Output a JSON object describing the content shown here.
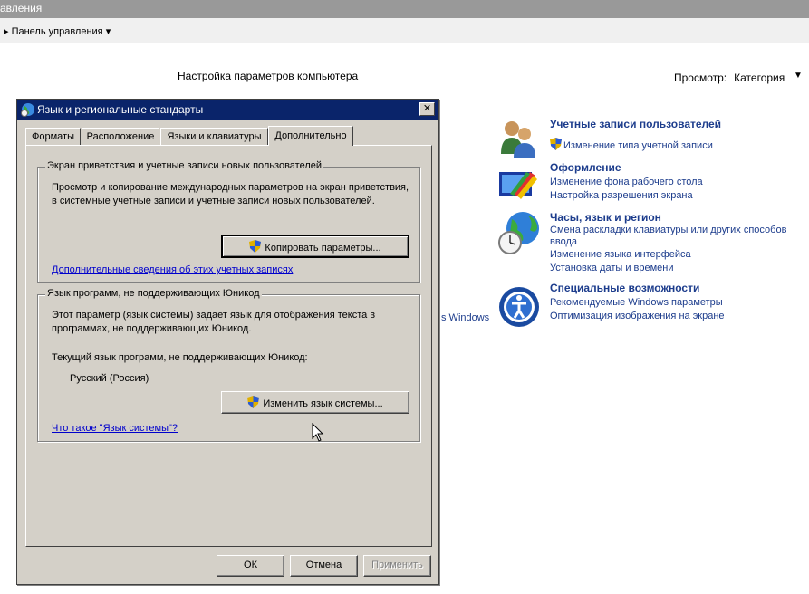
{
  "control_panel": {
    "title_fragment": "авления",
    "breadcrumb": "Панель управления",
    "header": "Настройка параметров компьютера",
    "view_label": "Просмотр:",
    "view_value": "Категория",
    "leftover_text": "s Windows",
    "categories": [
      {
        "title": "Учетные записи пользователей",
        "icon": "users-icon",
        "links": [
          "Изменение типа учетной записи"
        ]
      },
      {
        "title": "Оформление",
        "icon": "appearance-icon",
        "links": [
          "Изменение фона рабочего стола",
          "Настройка разрешения экрана"
        ]
      },
      {
        "title": "Часы, язык и регион",
        "icon": "clock-globe-icon",
        "links": [
          "Смена раскладки клавиатуры или других способов ввода",
          "Изменение языка интерфейса",
          "Установка даты и времени"
        ]
      },
      {
        "title": "Специальные возможности",
        "icon": "accessibility-icon",
        "links": [
          "Рекомендуемые Windows параметры",
          "Оптимизация изображения на экране"
        ]
      }
    ]
  },
  "dialog": {
    "title": "Язык и региональные стандарты",
    "tabs": [
      "Форматы",
      "Расположение",
      "Языки и клавиатуры",
      "Дополнительно"
    ],
    "active_tab": "Дополнительно",
    "welcome_group": {
      "title": "Экран приветствия и учетные записи новых пользователей",
      "description": "Просмотр и копирование международных параметров на экран приветствия, в системные учетные записи и учетные записи новых пользователей.",
      "copy_button": "Копировать параметры...",
      "link": "Дополнительные сведения об этих учетных записях"
    },
    "unicode_group": {
      "title": "Язык программ, не поддерживающих Юникод",
      "description": "Этот параметр (язык системы) задает язык для отображения текста в программах, не поддерживающих Юникод.",
      "current_label": "Текущий язык программ, не поддерживающих Юникод:",
      "current_value": "Русский (Россия)",
      "change_button": "Изменить язык системы...",
      "link": "Что такое \"Язык системы\"?"
    },
    "buttons": {
      "ok": "ОК",
      "cancel": "Отмена",
      "apply": "Применить"
    }
  },
  "colors": {
    "titlebar_active": "#0a246a",
    "dialog_face": "#d4d0c8",
    "link": "#0000cc",
    "cp_link": "#1c3c8c"
  }
}
